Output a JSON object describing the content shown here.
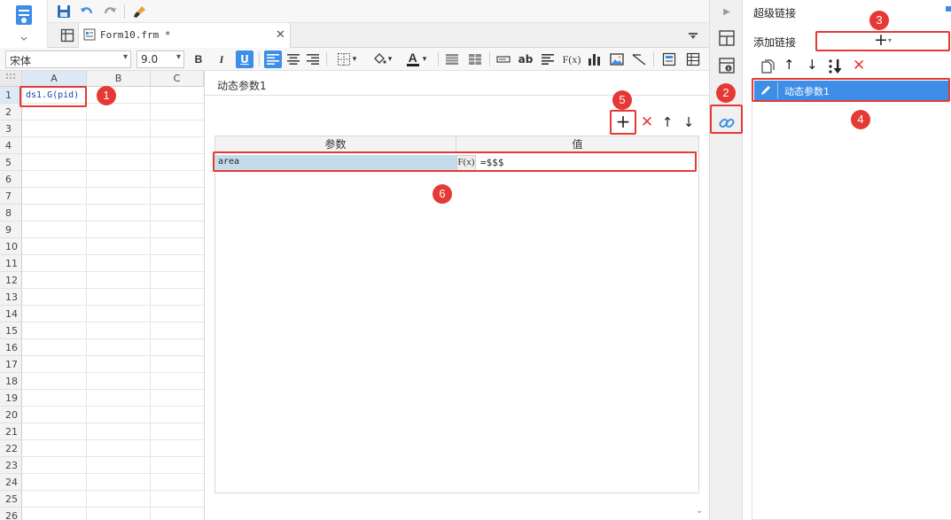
{
  "file_tab": {
    "name": "Form10.frm *"
  },
  "format_bar": {
    "font_name": "宋体",
    "font_size": "9.0",
    "bold": "B",
    "italic": "I",
    "underline": "U",
    "text_icon": "ab",
    "formula_icon": "F(x)"
  },
  "sheet": {
    "columns": [
      "A",
      "B",
      "C"
    ],
    "rows": [
      "1",
      "2",
      "3",
      "4",
      "5",
      "6",
      "7",
      "8",
      "9",
      "10",
      "11",
      "12",
      "13",
      "14",
      "15",
      "16",
      "17",
      "18",
      "19",
      "20",
      "21",
      "22",
      "23",
      "24",
      "25",
      "26"
    ],
    "cell_a1": "ds1.G(pid)"
  },
  "dialog": {
    "title": "动态参数1",
    "columns": {
      "param": "参数",
      "value": "值"
    },
    "row": {
      "param": "area",
      "fx": "F(x)",
      "value": "=$$$"
    }
  },
  "right_panel": {
    "title": "超级链接",
    "add_label": "添加链接",
    "link_item": "动态参数1"
  },
  "badges": [
    "1",
    "2",
    "3",
    "4",
    "5",
    "6"
  ],
  "colors": {
    "accent": "#3d8ee6",
    "selected_row": "#3d8ee6",
    "param_cell": "#c5dbe9",
    "red": "#e53935"
  }
}
